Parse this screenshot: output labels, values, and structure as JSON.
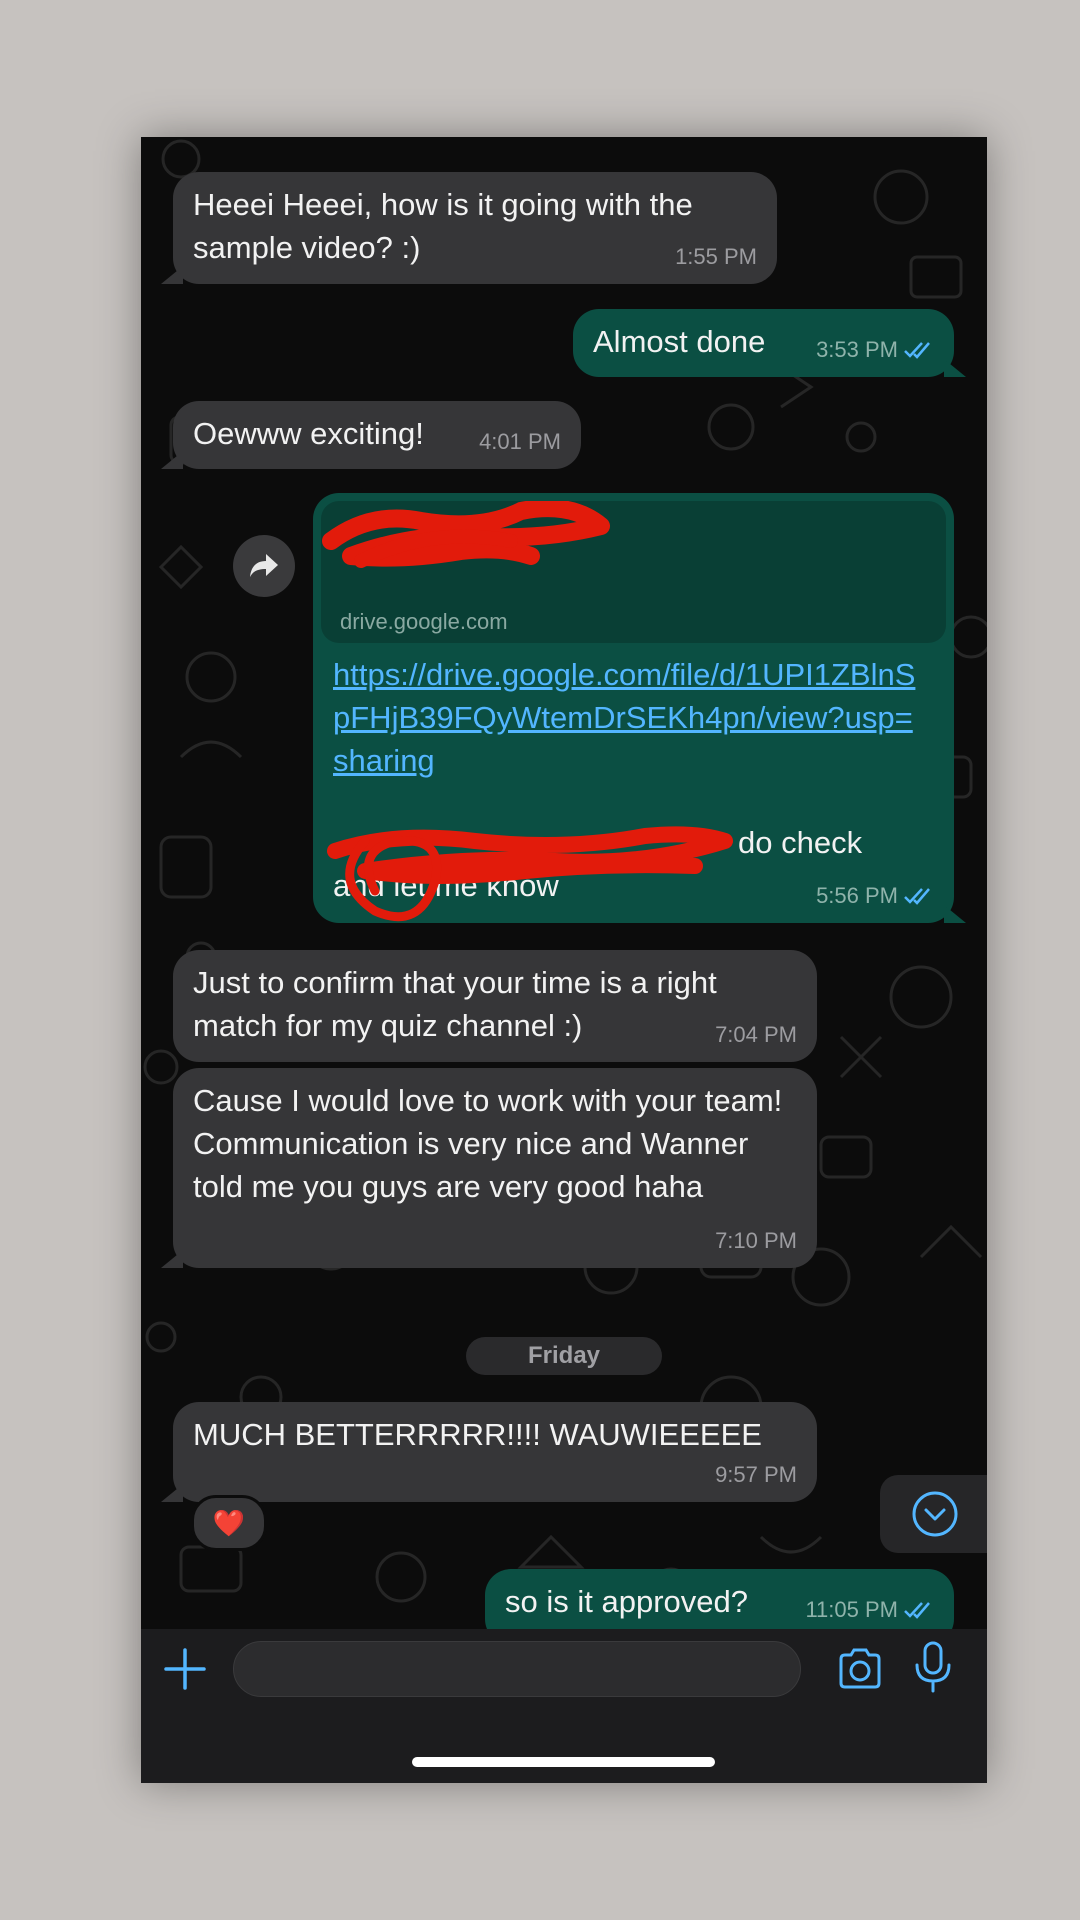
{
  "messages": [
    {
      "text": "Heeei Heeei, how is it going with the sample video? :)",
      "time": "1:55 PM"
    },
    {
      "text": "Almost done",
      "time": "3:53 PM"
    },
    {
      "text": "Oewww exciting!",
      "time": "4:01 PM"
    },
    {
      "link_domain": "drive.google.com",
      "link_url": "https://drive.google.com/file/d/1UPI1ZBlnSpFHjB39FQyWtemDrSEKh4pn/view?usp=sharing",
      "caption": "do check and let me know",
      "time": "5:56 PM"
    },
    {
      "text": "Just to confirm that your time is a right match for my quiz channel :)",
      "time": "7:04 PM"
    },
    {
      "text": "Cause I would love to work with your team! Communication is very nice and Wanner told me you guys are very good haha",
      "time": "7:10 PM"
    },
    {
      "text": "MUCH BETTERRRRR!!!! WAUWIEEEEE",
      "time": "9:57 PM",
      "reaction": "❤️"
    },
    {
      "text": "so is it approved?",
      "time": "11:05 PM"
    }
  ],
  "date_separator": "Friday",
  "composer": {
    "value": ""
  },
  "colors": {
    "incoming_bubble": "#363638",
    "outgoing_bubble": "#0b4f43",
    "accent_blue": "#53b6ff",
    "redaction": "#e21b0b"
  },
  "icons": [
    "forward-icon",
    "double-check-icon",
    "plus-icon",
    "sticker-icon",
    "camera-icon",
    "microphone-icon",
    "chevron-down-icon",
    "heart-reaction"
  ]
}
